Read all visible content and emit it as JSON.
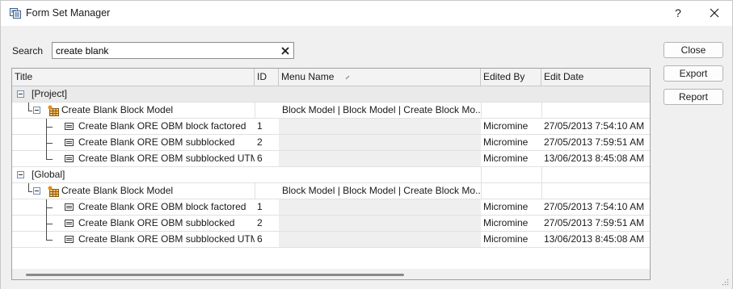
{
  "window": {
    "title": "Form Set Manager",
    "help_label": "?"
  },
  "search": {
    "label": "Search",
    "value": "create blank"
  },
  "buttons": {
    "close": "Close",
    "export": "Export",
    "report": "Report"
  },
  "columns": {
    "title": "Title",
    "id": "ID",
    "menu_name": "Menu Name",
    "edited_by": "Edited By",
    "edit_date": "Edit Date"
  },
  "groups": [
    {
      "label": "[Project]",
      "parent": {
        "title": "Create Blank Block Model",
        "menu_name": "Block Model | Block Model | Create Block Mo..."
      },
      "children": [
        {
          "title": "Create Blank ORE OBM block factored",
          "id": "1",
          "edited_by": "Micromine",
          "edit_date": "27/05/2013 7:54:10 AM"
        },
        {
          "title": "Create Blank ORE OBM subblocked",
          "id": "2",
          "edited_by": "Micromine",
          "edit_date": "27/05/2013 7:59:51 AM"
        },
        {
          "title": "Create Blank ORE OBM subblocked UTM",
          "id": "6",
          "edited_by": "Micromine",
          "edit_date": "13/06/2013 8:45:08 AM"
        }
      ]
    },
    {
      "label": "[Global]",
      "parent": {
        "title": "Create Blank Block Model",
        "menu_name": "Block Model | Block Model | Create Block Mo..."
      },
      "children": [
        {
          "title": "Create Blank ORE OBM block factored",
          "id": "1",
          "edited_by": "Micromine",
          "edit_date": "27/05/2013 7:54:10 AM"
        },
        {
          "title": "Create Blank ORE OBM subblocked",
          "id": "2",
          "edited_by": "Micromine",
          "edit_date": "27/05/2013 7:59:51 AM"
        },
        {
          "title": "Create Blank ORE OBM subblocked UTM",
          "id": "6",
          "edited_by": "Micromine",
          "edit_date": "13/06/2013 8:45:08 AM"
        }
      ]
    }
  ],
  "icons": {
    "app": "form-set-manager-icon",
    "close": "close-icon",
    "clear": "clear-search-icon",
    "collapse": "collapse-icon",
    "block_model": "block-model-icon",
    "form": "form-icon",
    "sort": "sort-indicator-icon",
    "grip": "resize-grip-icon"
  }
}
